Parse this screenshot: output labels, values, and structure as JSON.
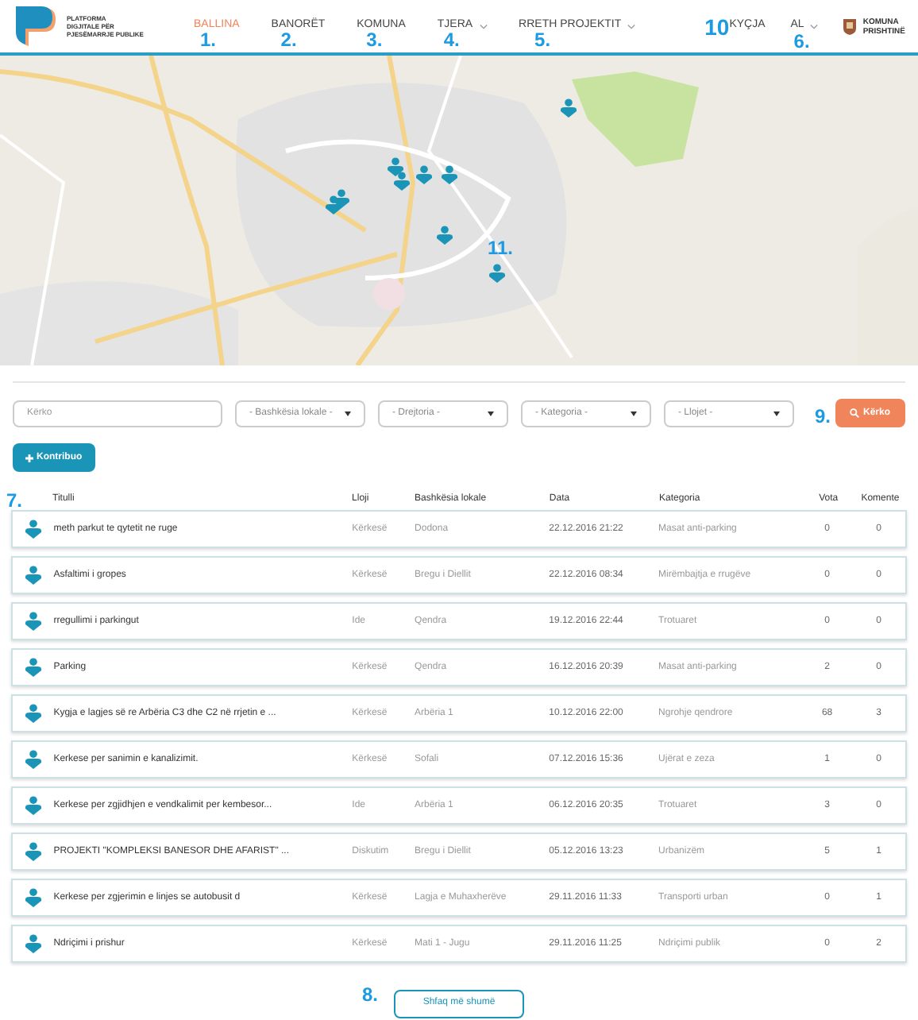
{
  "logo": {
    "lines": [
      "PLATFORMA",
      "DIGJITALE PËR",
      "PJESËMARRJE PUBLIKE"
    ]
  },
  "nav": [
    {
      "label": "BALLINA",
      "selected": true,
      "dropdown": false,
      "annotation": "1."
    },
    {
      "label": "BANORËT",
      "selected": false,
      "dropdown": false,
      "annotation": "2."
    },
    {
      "label": "KOMUNA",
      "selected": false,
      "dropdown": false,
      "annotation": "3."
    },
    {
      "label": "TJERA",
      "selected": false,
      "dropdown": true,
      "annotation": "4."
    },
    {
      "label": "RRETH PROJEKTIT",
      "selected": false,
      "dropdown": true,
      "annotation": "5."
    }
  ],
  "login": {
    "label": "KYÇJA",
    "annotation": "10"
  },
  "language": {
    "label": "AL",
    "annotation": "6."
  },
  "municipality": {
    "lines": [
      "KOMUNA",
      "PRISHTINË"
    ]
  },
  "map": {
    "annotation": "11."
  },
  "filters": {
    "placeholder": "Kërko",
    "selects": [
      "- Bashkësia lokale -",
      "- Drejtoria -",
      "- Kategoria -",
      "- Llojet -"
    ],
    "search_button": "Kërko",
    "annotation": "9."
  },
  "contribute_button": "Kontribuo",
  "table": {
    "annotation": "7.",
    "columns": [
      "Titulli",
      "Lloji",
      "Bashkësia lokale",
      "Data",
      "Kategoria",
      "Vota",
      "Komente"
    ],
    "rows": [
      [
        "meth parkut te qytetit ne ruge",
        "Kërkesë",
        "Dodona",
        "22.12.2016 21:22",
        "Masat anti-parking",
        "0",
        "0"
      ],
      [
        "Asfaltimi i gropes",
        "Kërkesë",
        "Bregu i Diellit",
        "22.12.2016 08:34",
        "Mirëmbajtja e rrugëve",
        "0",
        "0"
      ],
      [
        "rregullimi i parkingut",
        "Ide",
        "Qendra",
        "19.12.2016 22:44",
        "Trotuaret",
        "0",
        "0"
      ],
      [
        "Parking",
        "Kërkesë",
        "Qendra",
        "16.12.2016 20:39",
        "Masat anti-parking",
        "2",
        "0"
      ],
      [
        "Kygja e lagjes së re Arbëria C3 dhe C2 në rrjetin e ...",
        "Kërkesë",
        "Arbëria 1",
        "10.12.2016 22:00",
        "Ngrohje qendrore",
        "68",
        "3"
      ],
      [
        "Kerkese per sanimin e kanalizimit.",
        "Kërkesë",
        "Sofali",
        "07.12.2016 15:36",
        "Ujërat e zeza",
        "1",
        "0"
      ],
      [
        "Kerkese per zgjidhjen e vendkalimit per kembesor...",
        "Ide",
        "Arbëria 1",
        "06.12.2016 20:35",
        "Trotuaret",
        "3",
        "0"
      ],
      [
        "PROJEKTI \"KOMPLEKSI BANESOR DHE AFARIST\" ...",
        "Diskutim",
        "Bregu i Diellit",
        "05.12.2016 13:23",
        "Urbanizëm",
        "5",
        "1"
      ],
      [
        "Kerkese per zgjerimin e linjes se autobusit d",
        "Kërkesë",
        "Lagja e Muhaxherëve",
        "29.11.2016 11:33",
        "Transporti urban",
        "0",
        "1"
      ],
      [
        "Ndriçimi i prishur",
        "Kërkesë",
        "Mati 1 - Jugu",
        "29.11.2016 11:25",
        "Ndriçimi publik",
        "0",
        "2"
      ]
    ]
  },
  "more_button": {
    "label": "Shfaq më shumë",
    "annotation": "8."
  }
}
